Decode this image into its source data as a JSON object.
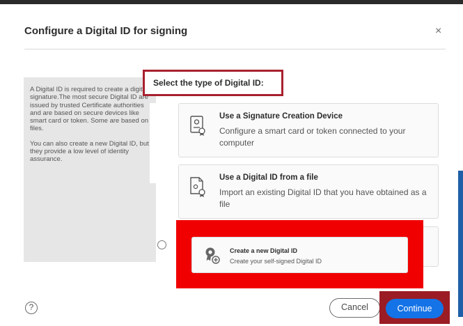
{
  "dialog": {
    "title": "Configure a Digital ID for signing",
    "close_glyph": "×"
  },
  "info_panel": {
    "paragraph1": "A Digital ID is required to create a digital signature.The most secure Digital ID are issued by trusted Certificate authorities and are based on secure devices like smart card or token. Some are based on files.",
    "paragraph2": "You can also create a new Digital ID, but they provide a low level of identity assurance."
  },
  "select_label": "Select the type of Digital ID:",
  "options": [
    {
      "title": "Use a Signature Creation Device",
      "description": "Configure a smart card or token connected to your computer",
      "icon": "signature-device-icon"
    },
    {
      "title": "Use a Digital ID from a file",
      "description": "Import an existing Digital ID that you have obtained as a file",
      "icon": "digital-id-file-icon"
    },
    {
      "title": "Create a new Digital ID",
      "description": "Create your self-signed Digital ID",
      "icon": "new-digital-id-icon",
      "selected": false
    }
  ],
  "footer": {
    "help_glyph": "?",
    "cancel_label": "Cancel",
    "continue_label": "Continue"
  },
  "colors": {
    "accent": "#1473e6",
    "highlight_red": "#f00000",
    "highlight_dark_red": "#9b1c25"
  }
}
